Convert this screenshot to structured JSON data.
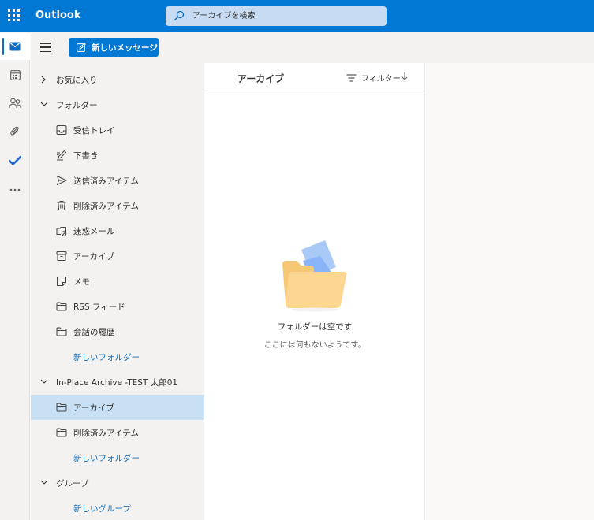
{
  "header": {
    "app_name": "Outlook",
    "search_placeholder": "アーカイブを検索"
  },
  "rail": {
    "items": [
      {
        "icon": "mail-icon",
        "active": true
      },
      {
        "icon": "calendar-icon",
        "active": false
      },
      {
        "icon": "people-icon",
        "active": false
      },
      {
        "icon": "attach-icon",
        "active": false
      },
      {
        "icon": "todo-check-icon",
        "active": false
      },
      {
        "icon": "more-icon",
        "active": false
      }
    ]
  },
  "toolbar": {
    "new_message_label": "新しいメッセージ"
  },
  "folders": {
    "favorites_label": "お気に入り",
    "folders_label": "フォルダー",
    "items": [
      {
        "label": "受信トレイ",
        "icon": "inbox-icon"
      },
      {
        "label": "下書き",
        "icon": "draft-pen-icon"
      },
      {
        "label": "送信済みアイテム",
        "icon": "send-icon"
      },
      {
        "label": "削除済みアイテム",
        "icon": "trash-icon"
      },
      {
        "label": "迷惑メール",
        "icon": "junk-icon"
      },
      {
        "label": "アーカイブ",
        "icon": "archive-icon"
      },
      {
        "label": "メモ",
        "icon": "note-icon"
      },
      {
        "label": "RSS フィード",
        "icon": "folder-icon"
      },
      {
        "label": "会話の履歴",
        "icon": "folder-icon"
      }
    ],
    "new_folder_label": "新しいフォルダー",
    "archive_mailbox_label": "In-Place Archive -TEST 太郎01",
    "archive_items": [
      {
        "label": "アーカイブ",
        "icon": "folder-icon",
        "selected": true
      },
      {
        "label": "削除済みアイテム",
        "icon": "folder-icon",
        "selected": false
      }
    ],
    "archive_new_folder_label": "新しいフォルダー",
    "groups_label": "グループ",
    "new_group_label": "新しいグループ"
  },
  "message_list": {
    "title": "アーカイブ",
    "filter_label": "フィルター",
    "empty_title": "フォルダーは空です",
    "empty_subtitle": "ここには何もないようです。"
  },
  "colors": {
    "accent": "#0078d4",
    "selected": "#c7e0f4",
    "pane": "#f3f2f1"
  }
}
